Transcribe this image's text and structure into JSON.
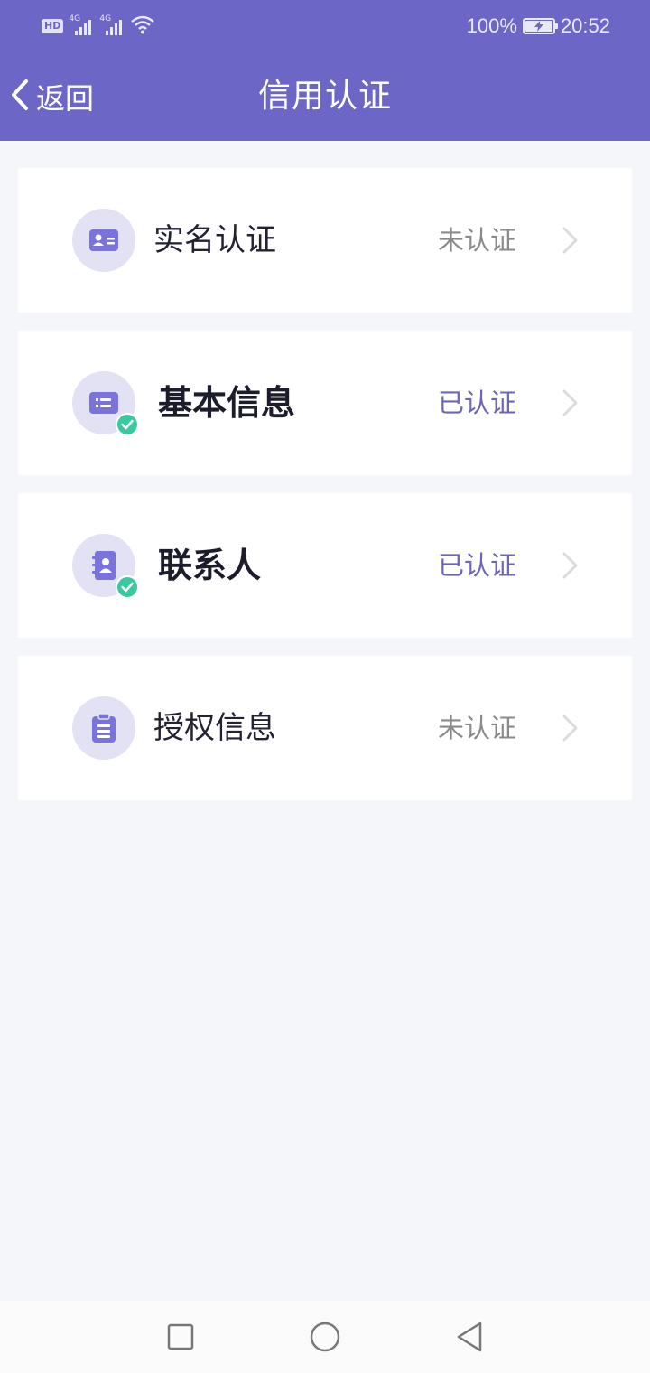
{
  "status_bar": {
    "hd": "HD",
    "network1": "4G",
    "network2": "4G",
    "battery_percent": "100%",
    "time": "20:52",
    "battery_level": 1.0
  },
  "header": {
    "back_label": "返回",
    "title": "信用认证",
    "background_color": "#6c66c6"
  },
  "items": [
    {
      "label": "实名认证",
      "status": "未认证",
      "verified": false,
      "icon": "id-card-icon"
    },
    {
      "label": "基本信息",
      "status": "已认证",
      "verified": true,
      "icon": "info-card-icon"
    },
    {
      "label": "联系人",
      "status": "已认证",
      "verified": true,
      "icon": "contacts-book-icon"
    },
    {
      "label": "授权信息",
      "status": "未认证",
      "verified": false,
      "icon": "clipboard-icon"
    }
  ],
  "colors": {
    "accent": "#6c66c6",
    "verified_text": "#6c66b8",
    "unverified_text": "#8a8a8a",
    "check_badge": "#38c9a0"
  },
  "system_nav": {
    "buttons": [
      "recent-apps-icon",
      "home-icon",
      "back-triangle-icon"
    ]
  }
}
